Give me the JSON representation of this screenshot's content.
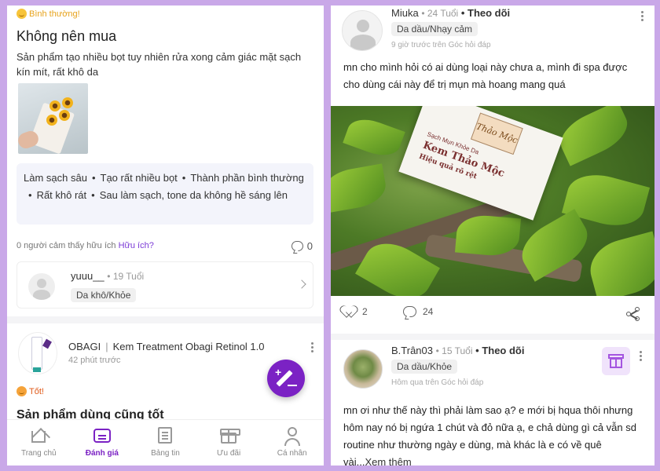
{
  "left": {
    "review": {
      "rating_label": "Bình thường!",
      "title": "Không nên mua",
      "text": "Sản phẩm tạo nhiều bọt tuy nhiên rửa xong cảm giác mặt sạch kín mít, rất khô da",
      "tags": [
        "Làm sạch sâu",
        "Tạo rất nhiều bọt",
        "Thành phần bình thường",
        "Rất khô rát",
        "Sau làm sạch, tone da không hề sáng lên"
      ],
      "helpful_text": "0 người cảm thấy hữu ích",
      "helpful_link": "Hữu ích?",
      "comment_count": "0",
      "user": {
        "name": "yuuu__",
        "age": "• 19 Tuổi",
        "skin": "Da khô/Khỏe"
      }
    },
    "product": {
      "brand": "OBAGI",
      "name": "Kem Treatment Obagi Retinol 1.0",
      "time": "42 phút trước",
      "rating_label": "Tốt!",
      "next_title": "Sản phẩm dùng cũng tốt"
    },
    "tabbar": [
      {
        "label": "Trang chủ",
        "icon": "home-icon"
      },
      {
        "label": "Đánh giá",
        "icon": "review-icon",
        "active": true
      },
      {
        "label": "Bảng tin",
        "icon": "news-icon"
      },
      {
        "label": "Ưu đãi",
        "icon": "gift-icon"
      },
      {
        "label": "Cá nhân",
        "icon": "user-icon"
      }
    ],
    "colors": {
      "accent": "#7b22c4",
      "neutral_badge": "#e7a21a",
      "good_badge": "#e05a1a"
    }
  },
  "right": {
    "post1": {
      "user": "Miuka",
      "age": "• 24 Tuổi",
      "follow": "• Theo dõi",
      "skin": "Da dầu/Nhạy cảm",
      "time": "9 giờ trước trên Góc hỏi đáp",
      "text": "mn cho mình hỏi có ai dùng loại này chưa a, mình đi spa được cho dùng cái này để trị mụn mà hoang mang quá",
      "image_text": {
        "logo": "Thảo Mộc",
        "line1": "Sạch Mụn Khỏe Da",
        "line2": "Kem Thảo Mộc",
        "line3": "Hiệu quả rõ rệt"
      },
      "likes": "2",
      "comments": "24"
    },
    "post2": {
      "user": "B.Trân03",
      "age": "• 15 Tuổi",
      "follow": "• Theo dõi",
      "skin": "Da dầu/Khỏe",
      "time": "Hôm qua trên Góc hỏi đáp",
      "text": "mn ơi như thế này thì phải làm sao ạ? e mới bị hqua thôi nhưng hôm nay nó bị ngứa 1 chút và đỏ nữa ạ, e chả dùng gì cả vẫn sd routine như thường ngày e dùng, mà khác là e có về quê vài...",
      "more": "Xem thêm"
    }
  }
}
